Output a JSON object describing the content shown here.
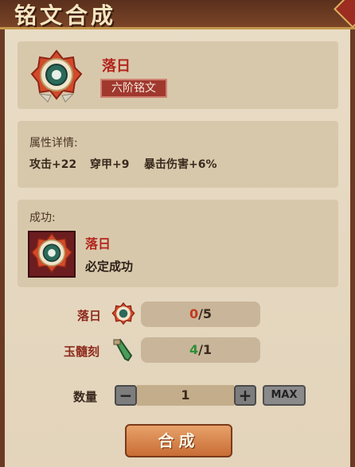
{
  "window": {
    "title": "铭文合成"
  },
  "rune": {
    "name": "落日",
    "tier": "六阶铭文"
  },
  "attributes": {
    "header": "属性详情:",
    "stats": [
      "攻击+22",
      "穿甲+9",
      "暴击伤害+6%"
    ]
  },
  "success": {
    "header": "成功:",
    "result_name": "落日",
    "result_note": "必定成功"
  },
  "requirements": [
    {
      "label": "落日",
      "icon": "rune-icon",
      "have": "0",
      "sep": "/",
      "need": "5",
      "have_color": "#c23b1f"
    },
    {
      "label": "玉髓刻",
      "icon": "jade-carving-icon",
      "have": "4",
      "sep": "/",
      "need": "1",
      "have_color": "#2f8f3a"
    }
  ],
  "quantity": {
    "label": "数量",
    "value": "1",
    "minus": "−",
    "plus": "+",
    "max_label": "MAX"
  },
  "action": {
    "craft_label": "合成"
  }
}
